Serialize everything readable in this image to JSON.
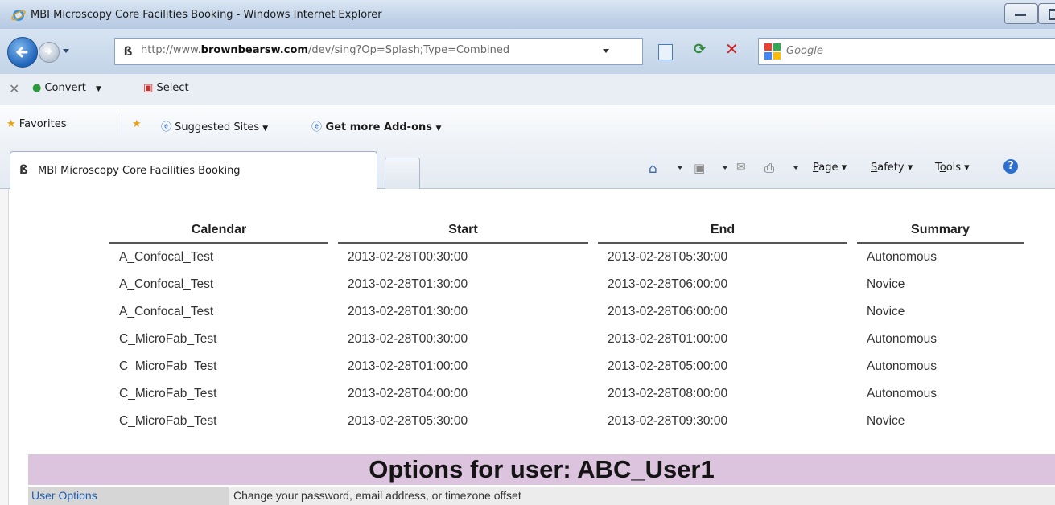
{
  "window": {
    "title": "MBI Microscopy Core Facilities Booking - Windows Internet Explorer"
  },
  "address_bar": {
    "url_prefix": "http://www.",
    "url_domain": "brownbearsw.com",
    "url_path": "/dev/sing?Op=Splash;Type=Combined",
    "search_placeholder": "Google"
  },
  "command_bar": {
    "convert_label": "Convert",
    "select_label": "Select"
  },
  "favorites_bar": {
    "favorites_label": "Favorites",
    "suggested_sites_label": "Suggested Sites",
    "addons_label": "Get more Add-ons"
  },
  "tab": {
    "title": "MBI Microscopy Core Facilities Booking"
  },
  "toolbar": {
    "page_label": "Page",
    "page_access_key": "P",
    "safety_label": "Safety",
    "safety_access_key": "S",
    "tools_label": "Tools",
    "tools_access_key": "o"
  },
  "bookings": {
    "columns": [
      "Calendar",
      "Start",
      "End",
      "Summary"
    ],
    "rows": [
      {
        "calendar": "A_Confocal_Test",
        "start": "2013-02-28T00:30:00",
        "end": "2013-02-28T05:30:00",
        "summary": "Autonomous"
      },
      {
        "calendar": "A_Confocal_Test",
        "start": "2013-02-28T01:30:00",
        "end": "2013-02-28T06:00:00",
        "summary": "Novice"
      },
      {
        "calendar": "A_Confocal_Test",
        "start": "2013-02-28T01:30:00",
        "end": "2013-02-28T06:00:00",
        "summary": "Novice"
      },
      {
        "calendar": "C_MicroFab_Test",
        "start": "2013-02-28T00:30:00",
        "end": "2013-02-28T01:00:00",
        "summary": "Autonomous"
      },
      {
        "calendar": "C_MicroFab_Test",
        "start": "2013-02-28T01:00:00",
        "end": "2013-02-28T05:00:00",
        "summary": "Autonomous"
      },
      {
        "calendar": "C_MicroFab_Test",
        "start": "2013-02-28T04:00:00",
        "end": "2013-02-28T08:00:00",
        "summary": "Autonomous"
      },
      {
        "calendar": "C_MicroFab_Test",
        "start": "2013-02-28T05:30:00",
        "end": "2013-02-28T09:30:00",
        "summary": "Novice"
      }
    ]
  },
  "options": {
    "heading": "Options for user: ABC_User1",
    "user_options_link": "User Options",
    "user_options_desc": "Change your password, email address, or timezone offset"
  },
  "colors": {
    "options_heading_bg": "#dcc4df",
    "link": "#1d5eb0",
    "chrome": "#c6d6ea"
  }
}
